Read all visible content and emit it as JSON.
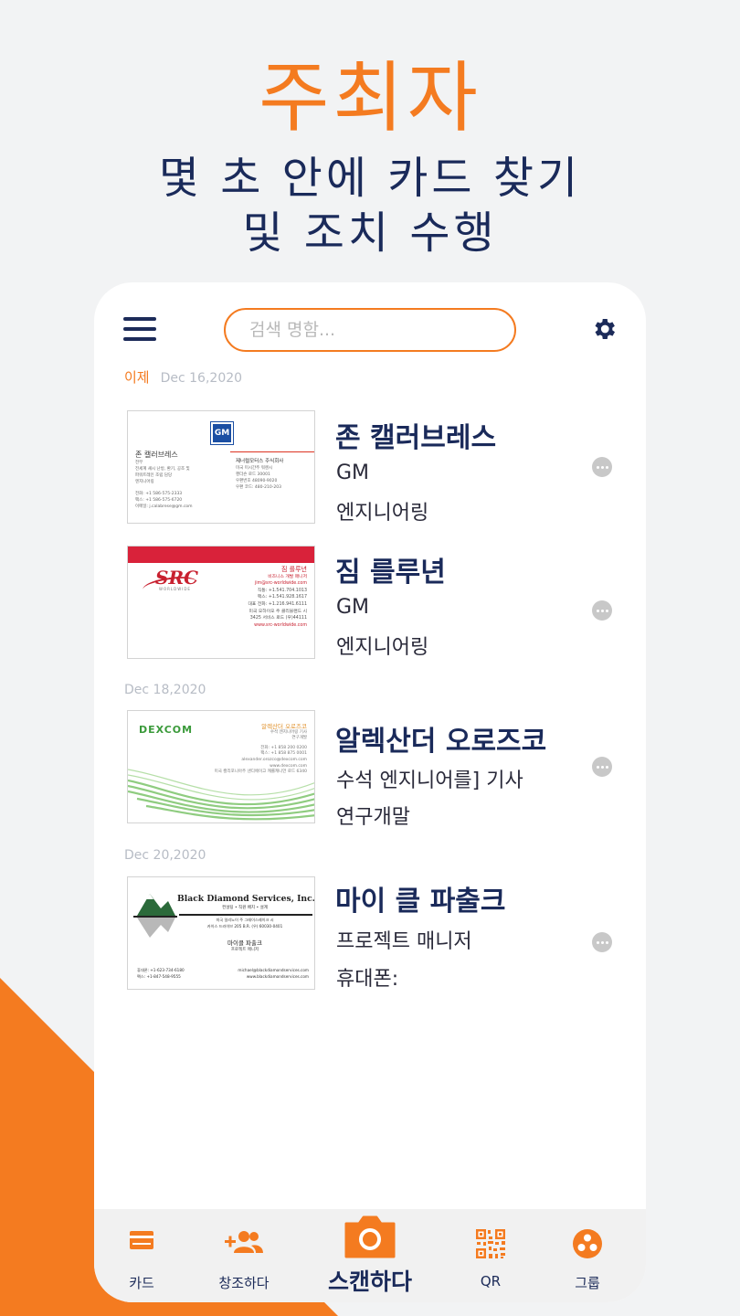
{
  "promo": {
    "headline": "주최자",
    "subline1": "몇 초 안에 카드 찾기",
    "subline2": "및 조치 수행"
  },
  "app": {
    "menu_icon": "hamburger-menu-icon",
    "search_placeholder": "검색 명함...",
    "settings_icon": "gear-icon",
    "groups": [
      {
        "label_today": "이제",
        "date": "Dec 16,2020"
      },
      {
        "date": "Dec 18,2020"
      },
      {
        "date": "Dec 20,2020"
      }
    ],
    "contacts": [
      {
        "name": "존 캘러브레스",
        "line1": "GM",
        "line2": "엔지니어링",
        "card": {
          "logo": "GM",
          "person": "존 캘러브레스",
          "title": "전무",
          "detail1": "전세계 섀시 난방, 환기, 공조 및",
          "detail2": "파워트레인 조립 담당",
          "detail3": "엔지니어링",
          "phone": "전화: +1 586-575-2333",
          "fax": "팩스: +1 586-575-6720",
          "email": "이메일: j.calabrese@gm.com",
          "company": "제너럴모터스 주식회사",
          "addr1": "미국 미시간주 워렌시",
          "addr2": "헨더슨 로드 30001",
          "addr3": "우편번호 48090-9020",
          "addr4": "우편 코드: 480-210-203"
        }
      },
      {
        "name": "짐 를루년",
        "line1": "GM",
        "line2": "엔지니어링",
        "card": {
          "logo": "SRC",
          "logo_sub": "WORLDWIDE",
          "person": "짐 를루년",
          "title": "비즈니스 개발 매니저",
          "email": "jim@src-worldwide.com",
          "phone": "직통: +1.541.704.1013",
          "fax": "팩스: +1.541.928.1617",
          "main": "대표 전화: +1.216.941.6111",
          "addr1": "미국 오하이오 주 클리블랜드 시",
          "addr2": "3425 서비스 로드 (우)44111",
          "web": "www.src-worldwide.com"
        }
      },
      {
        "name": "알렉산더 오로즈코",
        "line1": "수석 엔지니어를] 기사",
        "line2": "연구개말",
        "card": {
          "logo": "DEXCOM",
          "person": "알렉산더 오로즈코",
          "title": "수석 엔지니어링 기사",
          "dept": "연구개발",
          "phone": "전화: +1 858 200 0200",
          "fax": "팩스: +1 858 875 0001",
          "email": "alexander.orozco@dexcom.com",
          "web": "www.dexcom.com",
          "addr": "미국 캘리포니아주 샌디에이고 캐롤캐니언 로드 6340"
        }
      },
      {
        "name": "마이 클 파출크",
        "line1": "프로젝트 매니저",
        "line2": "휴대폰:",
        "card": {
          "logo": "Black Diamond Services, Inc.",
          "tagline": "컨설팅 • 직원 배치 • 설계",
          "addr1": "미국 일리노이 주 그레이스레이크 시",
          "addr2": "카이스 드라이브 205 B.R. (우) 60030-0401",
          "person": "마이클 파출크",
          "title": "프로젝트 매니저",
          "phone": "휴대폰: +1-623-734-6180",
          "fax": "팩스: +1-847-548-9555",
          "email": "michael@blackdiamondservices.com",
          "web": "www.blackdiamondservices.com"
        }
      }
    ],
    "nav": [
      {
        "label": "카드",
        "icon": "card-icon"
      },
      {
        "label": "창조하다",
        "icon": "add-contact-icon"
      },
      {
        "label": "스캔하다",
        "icon": "camera-icon"
      },
      {
        "label": "QR",
        "icon": "qr-code-icon"
      },
      {
        "label": "그룹",
        "icon": "group-icon"
      }
    ],
    "colors": {
      "accent": "#f47b20",
      "navy": "#1c2b59"
    }
  }
}
